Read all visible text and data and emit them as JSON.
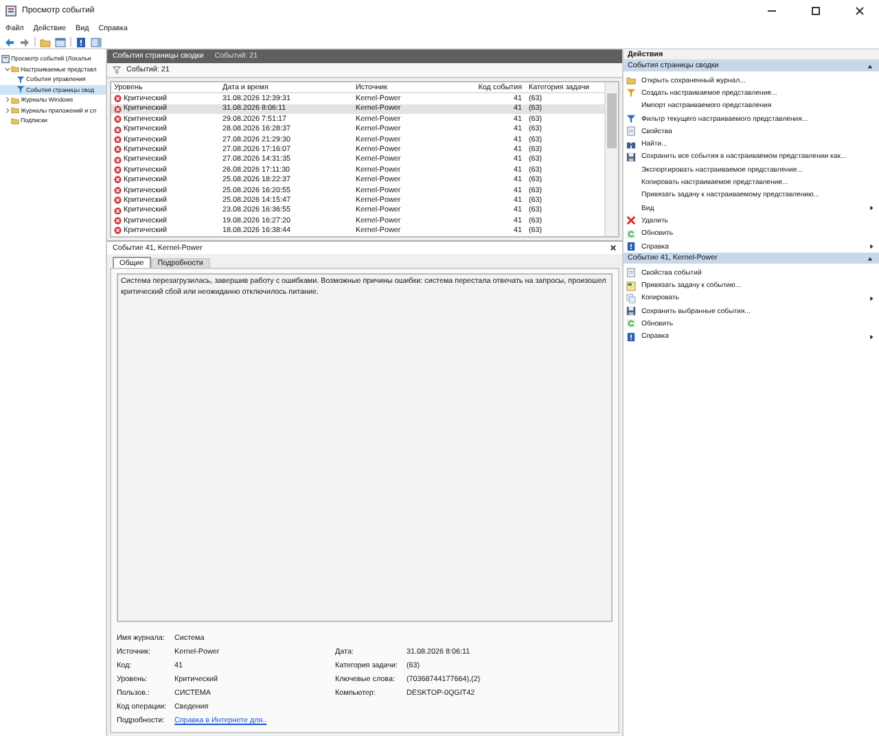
{
  "window": {
    "title": "Просмотр событий"
  },
  "menu": [
    "Файл",
    "Действие",
    "Вид",
    "Справка"
  ],
  "tree": [
    {
      "label": "Просмотр событий (Локальн",
      "selected": false,
      "children": [
        {
          "label": "Настраиваемые представл",
          "selected": false,
          "expanded": true,
          "children": [
            {
              "label": "События управления",
              "selected": false
            },
            {
              "label": "События страницы свод",
              "selected": true
            }
          ]
        },
        {
          "label": "Журналы Windows",
          "selected": false,
          "expanded": false
        },
        {
          "label": "Журналы приложений и сл",
          "selected": false,
          "expanded": false
        },
        {
          "label": "Подписки",
          "selected": false
        }
      ]
    }
  ],
  "center": {
    "header_title": "События страницы сводки",
    "header_count": "Событий: 21",
    "filter_text": "Событий: 21"
  },
  "table": {
    "columns": [
      "Уровень",
      "Дата и время",
      "Источник",
      "Код события",
      "Категория задачи"
    ],
    "rows": [
      {
        "level": "Критический",
        "datetime": "31.08.2026 12:39:31",
        "source": "Kernel-Power",
        "code": "41",
        "category": "(63)",
        "selected": false
      },
      {
        "level": "Критический",
        "datetime": "31.08.2026 8:06:11",
        "source": "Kernel-Power",
        "code": "41",
        "category": "(63)",
        "selected": true
      },
      {
        "level": "Критический",
        "datetime": "29.08.2026 7:51:17",
        "source": "Kernel-Power",
        "code": "41",
        "category": "(63)",
        "selected": false
      },
      {
        "level": "Критический",
        "datetime": "28.08.2026 16:28:37",
        "source": "Kernel-Power",
        "code": "41",
        "category": "(63)",
        "selected": false
      },
      {
        "level": "Критический",
        "datetime": "27.08.2026 21:29:30",
        "source": "Kernel-Power",
        "code": "41",
        "category": "(63)",
        "selected": false
      },
      {
        "level": "Критический",
        "datetime": "27.08.2026 17:16:07",
        "source": "Kernel-Power",
        "code": "41",
        "category": "(63)",
        "selected": false
      },
      {
        "level": "Критический",
        "datetime": "27.08.2026 14:31:35",
        "source": "Kernel-Power",
        "code": "41",
        "category": "(63)",
        "selected": false
      },
      {
        "level": "Критический",
        "datetime": "26.08.2026 17:11:30",
        "source": "Kernel-Power",
        "code": "41",
        "category": "(63)",
        "selected": false
      },
      {
        "level": "Критический",
        "datetime": "25.08.2026 18:22:37",
        "source": "Kernel-Power",
        "code": "41",
        "category": "(63)",
        "selected": false
      },
      {
        "level": "Критический",
        "datetime": "25.08.2026 16:20:55",
        "source": "Kernel-Power",
        "code": "41",
        "category": "(63)",
        "selected": false
      },
      {
        "level": "Критический",
        "datetime": "25.08.2026 14:15:47",
        "source": "Kernel-Power",
        "code": "41",
        "category": "(63)",
        "selected": false
      },
      {
        "level": "Критический",
        "datetime": "23.08.2026 16:36:55",
        "source": "Kernel-Power",
        "code": "41",
        "category": "(63)",
        "selected": false
      },
      {
        "level": "Критический",
        "datetime": "19.08.2026 16:27:20",
        "source": "Kernel-Power",
        "code": "41",
        "category": "(63)",
        "selected": false
      },
      {
        "level": "Критический",
        "datetime": "18.08.2026 16:38:44",
        "source": "Kernel-Power",
        "code": "41",
        "category": "(63)",
        "selected": false
      }
    ]
  },
  "details": {
    "title": "Событие 41, Kernel-Power",
    "tabs": [
      {
        "label": "Общие",
        "selected": true
      },
      {
        "label": "Подробности",
        "selected": false
      }
    ],
    "description": "Система перезагрузилась, завершив работу с ошибками. Возможные причины ошибки: система перестала отвечать на запросы, произошел критический сбой или неожиданно отключилось питание.",
    "left_fields": [
      {
        "label": "Имя журнала:",
        "value": "Система",
        "kind": "text"
      },
      {
        "label": "Источник:",
        "value": "Kernel-Power",
        "kind": "text"
      },
      {
        "label": "Код:",
        "value": "41",
        "kind": "text"
      },
      {
        "label": "Уровень:",
        "value": "Критический",
        "kind": "text"
      },
      {
        "label": "Пользов.:",
        "value": "СИСТЕМА",
        "kind": "text"
      },
      {
        "label": "Код операции:",
        "value": "Сведения",
        "kind": "text"
      },
      {
        "label": "Подробности:",
        "value": "Справка в Интернете для..",
        "kind": "link"
      }
    ],
    "right_fields": [
      {
        "label": "Дата:",
        "value": "31.08.2026 8:06:11"
      },
      {
        "label": "Категория задачи:",
        "value": "(63)"
      },
      {
        "label": "Ключевые слова:",
        "value": "(70368744177664),(2)"
      },
      {
        "label": "Компьютер:",
        "value": "DESKTOP-0QGIT42"
      }
    ]
  },
  "actions": {
    "title": "Действия",
    "sections": [
      {
        "title": "События страницы сводки",
        "expanded": true,
        "items": [
          {
            "label": "Открыть сохраненный журнал...",
            "submenu": false
          },
          {
            "label": "Создать настраиваемое представление...",
            "submenu": false
          },
          {
            "label": "Импорт настраиваемого представления",
            "submenu": false
          },
          {
            "label": "Фильтр текущего настраиваемого представления...",
            "submenu": false
          },
          {
            "label": "Свойства",
            "submenu": false
          },
          {
            "label": "Найти...",
            "submenu": false
          },
          {
            "label": "Сохранить все события в настраиваемом представлении как...",
            "submenu": false
          },
          {
            "label": "Экспортировать настраиваемое представление...",
            "submenu": false
          },
          {
            "label": "Копировать настраиваемое представление...",
            "submenu": false
          },
          {
            "label": "Привязать задачу к настраиваемому представлению...",
            "submenu": false
          },
          {
            "label": "Вид",
            "submenu": true
          },
          {
            "label": "Удалить",
            "submenu": false
          },
          {
            "label": "Обновить",
            "submenu": false
          },
          {
            "label": "Справка",
            "submenu": true
          }
        ]
      },
      {
        "title": "Событие 41, Kernel-Power",
        "expanded": true,
        "items": [
          {
            "label": "Свойства событий",
            "submenu": false
          },
          {
            "label": "Привязать задачу к событию...",
            "submenu": false
          },
          {
            "label": "Копировать",
            "submenu": true
          },
          {
            "label": "Сохранить выбранные события...",
            "submenu": false
          },
          {
            "label": "Обновить",
            "submenu": false
          },
          {
            "label": "Справка",
            "submenu": true
          }
        ]
      }
    ]
  }
}
